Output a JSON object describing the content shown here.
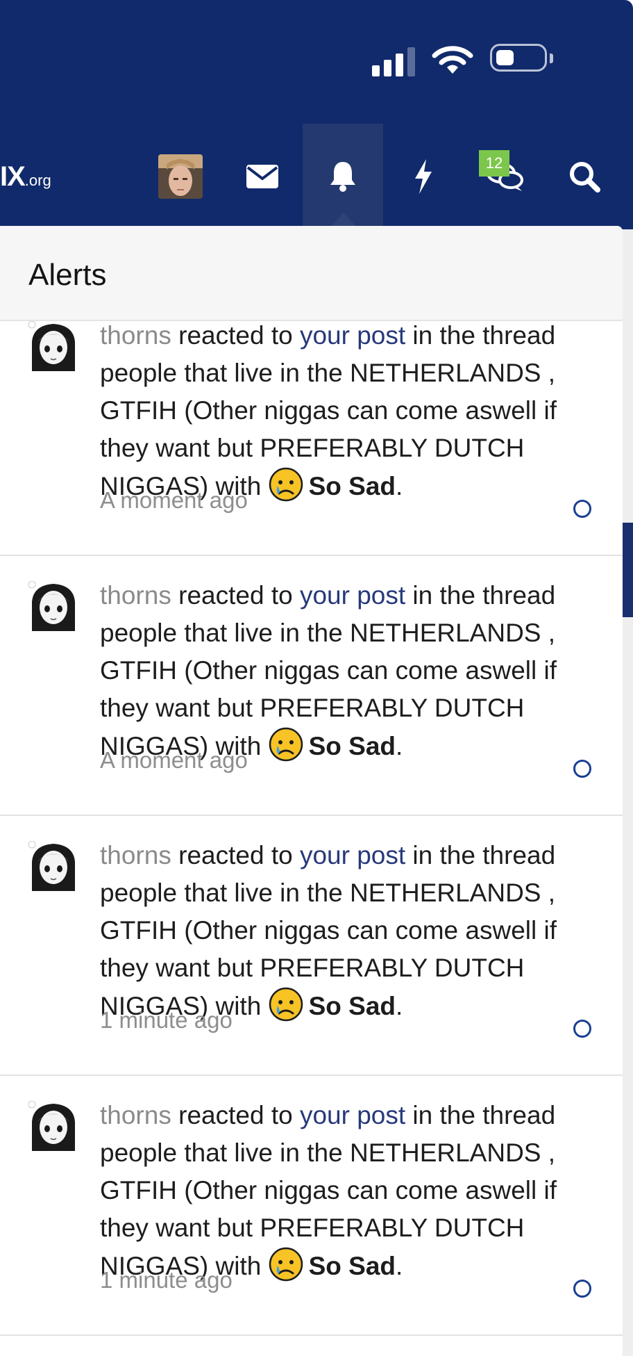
{
  "header": {
    "logo_main": "IX",
    "logo_tld": ".org",
    "nav": {
      "avatar": "profile-avatar",
      "messages_icon": "envelope-icon",
      "alerts_icon": "bell-icon",
      "whats_new_icon": "lightning-icon",
      "chat_icon": "chat-bubbles-icon",
      "chat_badge": "12",
      "search_icon": "search-icon",
      "active": "alerts"
    }
  },
  "status_bar": {
    "signal_bars": 4,
    "signal_active_bars": 3,
    "wifi_icon": "wifi-icon",
    "battery_level": 0.35
  },
  "panel": {
    "title": "Alerts"
  },
  "alerts": [
    {
      "user": "thorns",
      "verb": " reacted to ",
      "link": "your post",
      "mid": " in the thread people that live in the NETHERLANDS , GTFIH (Other niggas can come aswell if they want but PREFERABLY DUTCH NIGGAS) with ",
      "reaction": "So Sad",
      "end": ".",
      "time": "A moment ago"
    },
    {
      "user": "thorns",
      "verb": " reacted to ",
      "link": "your post",
      "mid": " in the thread people that live in the NETHERLANDS , GTFIH (Other niggas can come aswell if they want but PREFERABLY DUTCH NIGGAS) with ",
      "reaction": "So Sad",
      "end": ".",
      "time": "A moment ago"
    },
    {
      "user": "thorns",
      "verb": " reacted to ",
      "link": "your post",
      "mid": " in the thread people that live in the NETHERLANDS , GTFIH (Other niggas can come aswell if they want but PREFERABLY DUTCH NIGGAS) with ",
      "reaction": "So Sad",
      "end": ".",
      "time": "1 minute ago"
    },
    {
      "user": "thorns",
      "verb": " reacted to ",
      "link": "your post",
      "mid": " in the thread people that live in the NETHERLANDS , GTFIH (Other niggas can come aswell if they want but PREFERABLY DUTCH NIGGAS) with ",
      "reaction": "So Sad",
      "end": ".",
      "time": "1 minute ago"
    }
  ],
  "colors": {
    "header_bg": "#112a6b",
    "nav_active_bg": "#23396f",
    "badge_bg": "#7cc74b",
    "link": "#27397a",
    "username": "#8a8a8a"
  }
}
